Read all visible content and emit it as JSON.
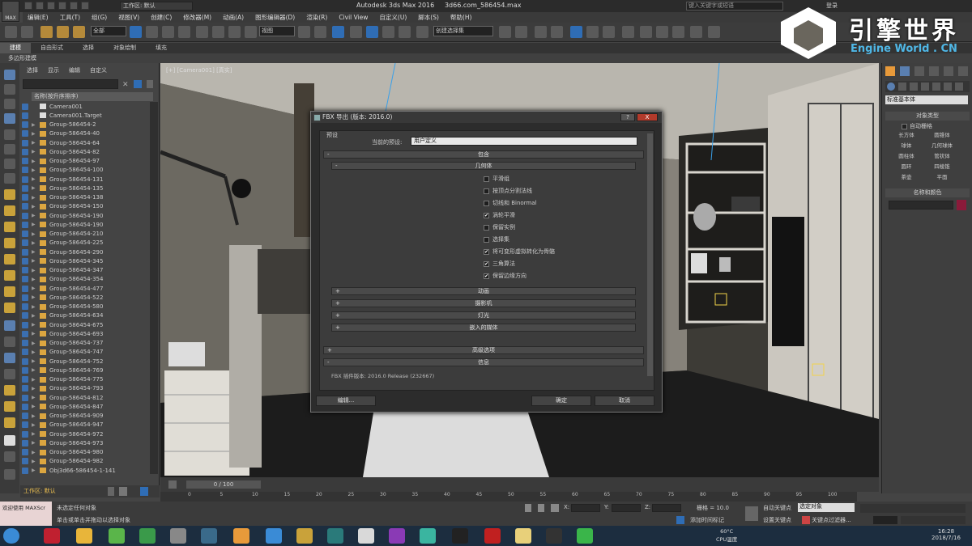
{
  "title_bar": {
    "workspace": "工作区: 默认",
    "app_title": "Autodesk 3ds Max 2016",
    "file_name": "3d66.com_586454.max",
    "search_placeholder": "键入关键字或短语",
    "login": "登录"
  },
  "menu": [
    "编辑(E)",
    "工具(T)",
    "组(G)",
    "视图(V)",
    "创建(C)",
    "修改器(M)",
    "动画(A)",
    "图形编辑器(D)",
    "渲染(R)",
    "Civil View",
    "自定义(U)",
    "脚本(S)",
    "帮助(H)"
  ],
  "toolbar": {
    "selection_filter": "全部",
    "ref_coord": "视图",
    "named_selection": "创建选择集"
  },
  "ribbon": {
    "tabs": [
      "建模",
      "自由形式",
      "选择",
      "对象绘制",
      "填充"
    ],
    "active": "建模",
    "sub_label": "多边形建模"
  },
  "scene_explorer": {
    "tabs": [
      "选择",
      "显示",
      "编辑",
      "自定义"
    ],
    "header": "名称(按升序排序)",
    "items": [
      "Camera001",
      "Camera001.Target",
      "Group-586454-2",
      "Group-586454-40",
      "Group-586454-64",
      "Group-586454-82",
      "Group-586454-97",
      "Group-586454-100",
      "Group-586454-131",
      "Group-586454-135",
      "Group-586454-138",
      "Group-586454-150",
      "Group-586454-190",
      "Group-586454-190",
      "Group-586454-210",
      "Group-586454-225",
      "Group-586454-290",
      "Group-586454-345",
      "Group-586454-347",
      "Group-586454-354",
      "Group-586454-477",
      "Group-586454-522",
      "Group-586454-580",
      "Group-586454-634",
      "Group-586454-675",
      "Group-586454-693",
      "Group-586454-737",
      "Group-586454-747",
      "Group-586454-752",
      "Group-586454-769",
      "Group-586454-775",
      "Group-586454-793",
      "Group-586454-812",
      "Group-586454-847",
      "Group-586454-909",
      "Group-586454-947",
      "Group-586454-972",
      "Group-586454-973",
      "Group-586454-980",
      "Group-586454-982",
      "Obj3d66-586454-1-141"
    ],
    "layer": "工作区: 默认"
  },
  "viewport": {
    "label": "[+] [Camera001] [真实]"
  },
  "command_panel": {
    "dropdown": "标准基本体",
    "rollout_object_type": "对象类型",
    "autogrid": "自动栅格",
    "buttons": [
      "长方体",
      "圆锥体",
      "球体",
      "几何球体",
      "圆柱体",
      "管状体",
      "圆环",
      "四棱锥",
      "茶壶",
      "平面"
    ],
    "rollout_name_color": "名称和颜色"
  },
  "dialog": {
    "title": "FBX 导出 (版本: 2016.0)",
    "help": "?",
    "close": "X",
    "preset_section": "预设",
    "preset_label": "当前的预设:",
    "preset_value": "用户定义",
    "include": "包含",
    "geometry": "几何体",
    "options": [
      {
        "label": "平滑组",
        "checked": false
      },
      {
        "label": "按顶点分割法线",
        "checked": false
      },
      {
        "label": "切线和 Binormal",
        "checked": false
      },
      {
        "label": "涡轮平滑",
        "checked": true
      },
      {
        "label": "保留实例",
        "checked": false
      },
      {
        "label": "选择集",
        "checked": false
      },
      {
        "label": "将可变形虚拟转化为骨骼",
        "checked": true
      },
      {
        "label": "三角算法",
        "checked": true
      },
      {
        "label": "保留边缘方向",
        "checked": true
      }
    ],
    "collapsed": [
      "动画",
      "摄影机",
      "灯光",
      "嵌入的媒体"
    ],
    "advanced": "高级选项",
    "info": "信息",
    "info_text": "FBX 插件版本: 2016.0 Release (232667)",
    "edit_btn": "编辑...",
    "ok_btn": "确定",
    "cancel_btn": "取消"
  },
  "timeline": {
    "frame": "0 / 100",
    "ticks": [
      "0",
      "5",
      "10",
      "15",
      "20",
      "25",
      "30",
      "35",
      "40",
      "45",
      "50",
      "55",
      "60",
      "65",
      "70",
      "75",
      "80",
      "85",
      "90",
      "95",
      "100"
    ]
  },
  "status": {
    "welcome": "欢迎使用 MAXScr",
    "line1": "未选定任何对象",
    "line2": "单击或单击并拖动以选择对象",
    "x_label": "X:",
    "y_label": "Y:",
    "z_label": "Z:",
    "grid": "栅格 = 10.0",
    "add_time_tag": "添加时间标记",
    "auto_key": "自动关键点",
    "set_key": "设置关键点",
    "selected_obj": "选定对象",
    "key_filters": "关键点过滤器..."
  },
  "taskbar": {
    "temp": "60°C",
    "temp_label": "CPU温度",
    "time": "16:28",
    "date": "2018/7/16"
  },
  "watermark": {
    "title": "引擎世界",
    "subtitle": "Engine World . CN"
  }
}
